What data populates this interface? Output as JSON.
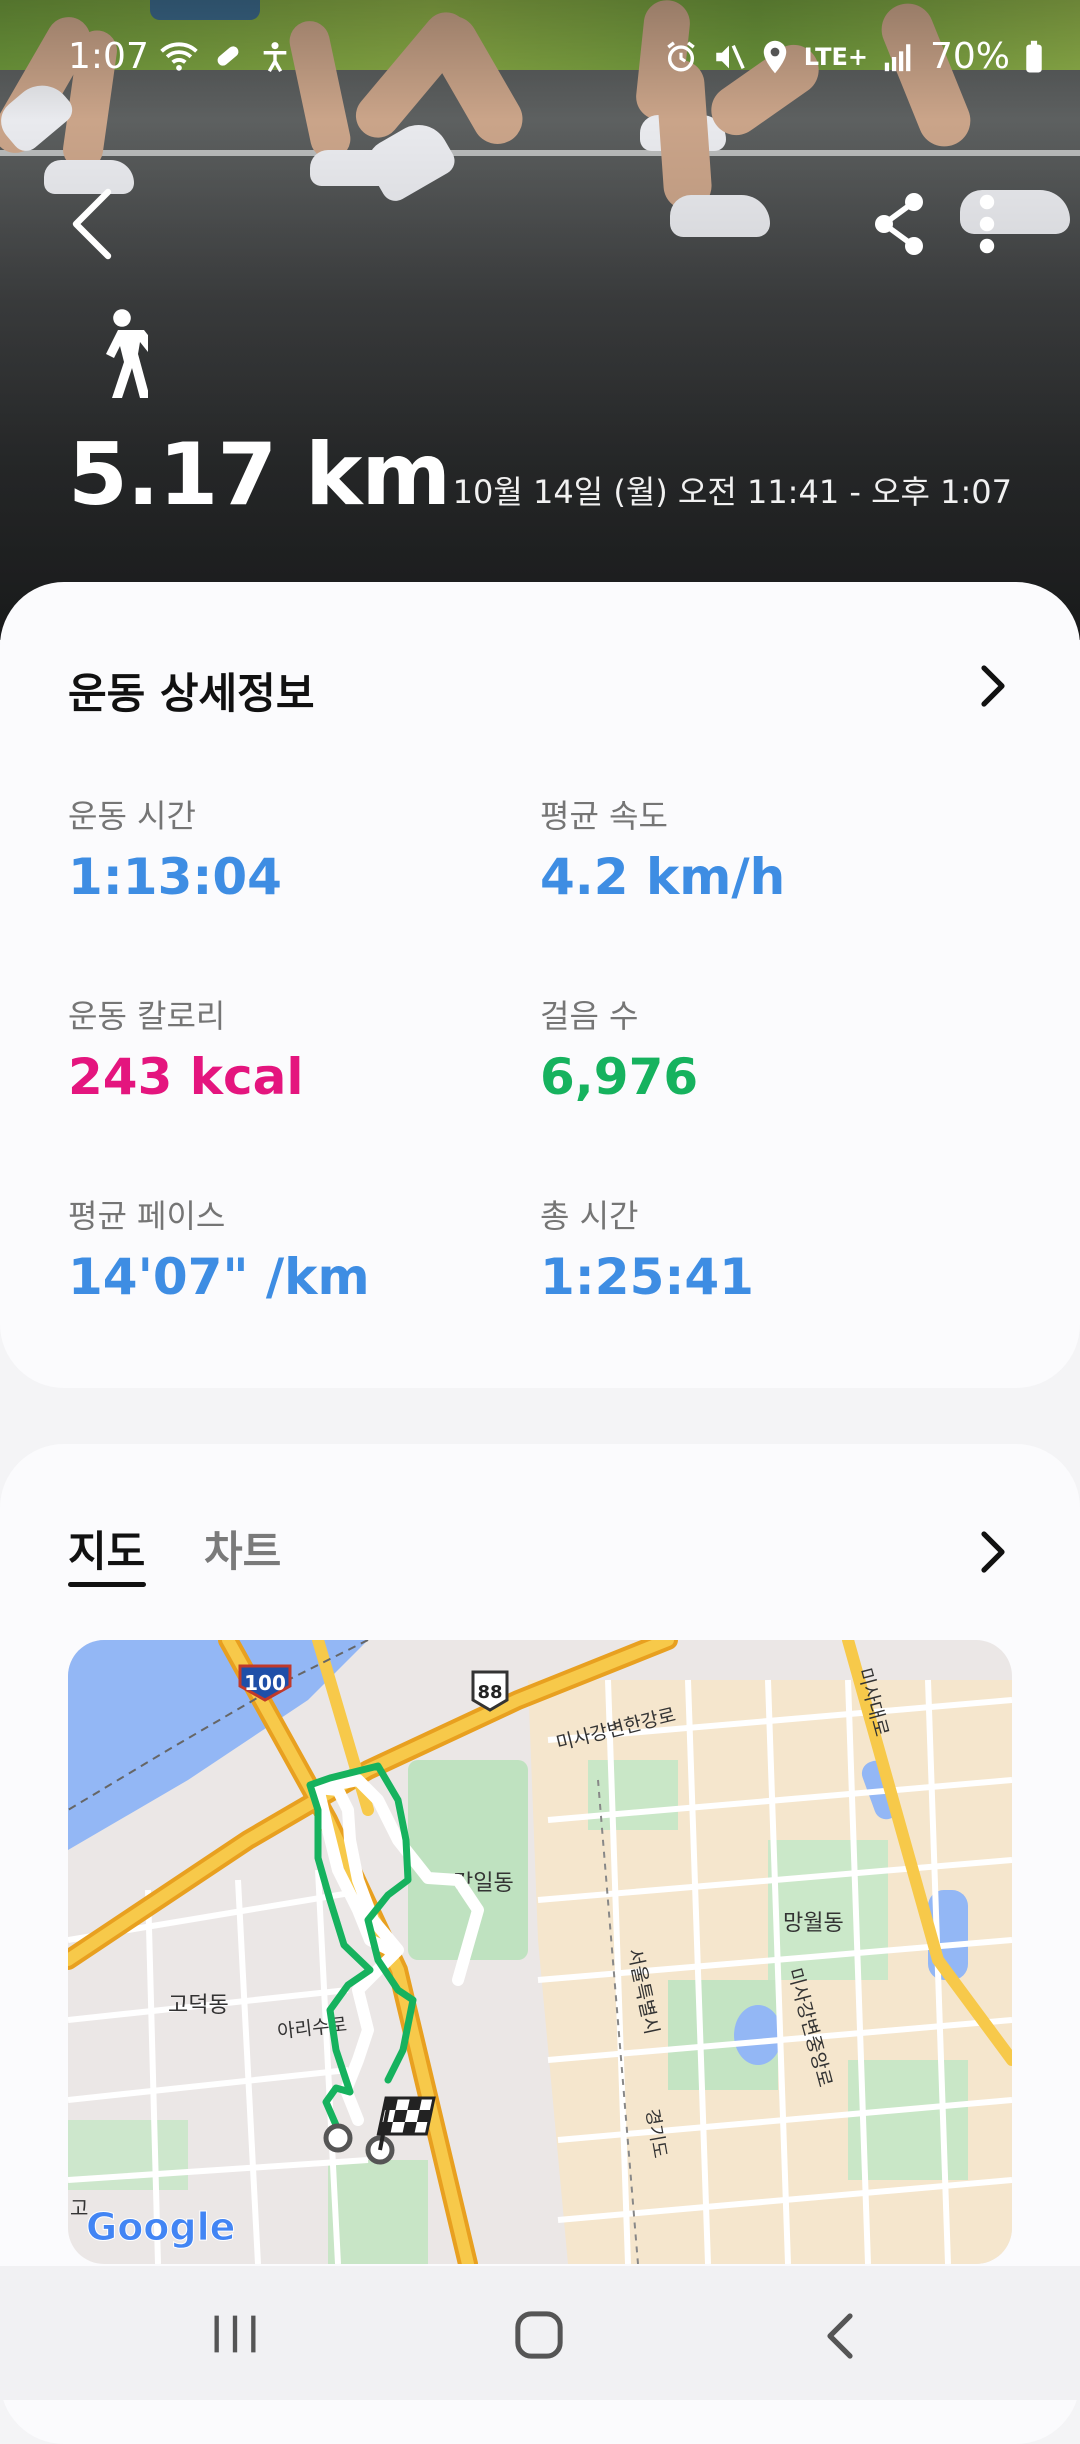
{
  "status_bar": {
    "time": "1:07",
    "network": "LTE+",
    "battery": "70%",
    "icons": [
      "wifi-icon",
      "pill-icon",
      "accessibility-icon",
      "alarm-icon",
      "mute-icon",
      "location-icon",
      "signal-icon",
      "battery-icon"
    ]
  },
  "header": {
    "activity_icon": "walk-icon",
    "distance": "5.17 km",
    "date_range": "10월 14일 (월) 오전 11:41 - 오후 1:07"
  },
  "details": {
    "title": "운동 상세정보",
    "stats": [
      {
        "label": "운동 시간",
        "value": "1:13:04",
        "color": "#3e8de3"
      },
      {
        "label": "평균 속도",
        "value": "4.2 km/h",
        "color": "#3e8de3"
      },
      {
        "label": "운동 칼로리",
        "value": "243 kcal",
        "color": "#e4157e"
      },
      {
        "label": "걸음 수",
        "value": "6,976",
        "color": "#16b25e"
      },
      {
        "label": "평균 페이스",
        "value": "14'07\" /km",
        "color": "#3e8de3"
      },
      {
        "label": "총 시간",
        "value": "1:25:41",
        "color": "#3e8de3"
      }
    ]
  },
  "map_section": {
    "tabs": [
      {
        "label": "지도",
        "selected": true
      },
      {
        "label": "차트",
        "selected": false
      }
    ],
    "map": {
      "route_color": "#16b25e",
      "route_markers": [
        "start-marker",
        "finish-flag"
      ],
      "highway_shields": [
        "100",
        "88"
      ],
      "labels": {
        "ganggil": "강일동",
        "mangwol": "망월동",
        "godeok": "고덕동",
        "arisu": "아리수로",
        "misa_riverside": "미사강변한강로",
        "misa_daero": "미사대로",
        "misa_jungang": "미사강변중앙로",
        "seoul": "서울특별시",
        "gyeonggi": "경기도",
        "partial_left": "고"
      },
      "attribution": "Google"
    }
  },
  "nav_bar": [
    "recent-apps-button",
    "home-button",
    "back-nav-button"
  ]
}
